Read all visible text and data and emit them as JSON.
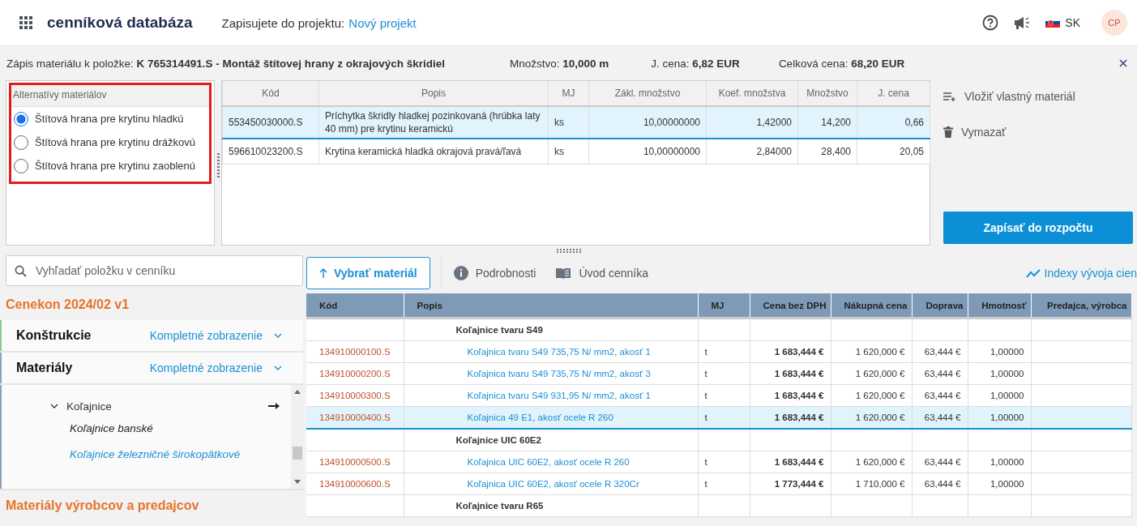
{
  "header": {
    "app_title": "cenníková databáza",
    "project_label": "Zapisujete do projektu:",
    "project_link": "Nový projekt",
    "language": "SK",
    "avatar": "CP"
  },
  "item_info": {
    "label": "Zápis materiálu k položke: **K 765314491.S - Montáž štítovej hrany z okrajových škridiel**",
    "quantity": "Množstvo: **10,000 m**",
    "unit_price": "J. cena: **6,82 EUR**",
    "total_price": "Celková cena: **68,20 EUR**"
  },
  "alternatives": {
    "title": "Alternatívy materiálov",
    "options": [
      {
        "label": "Štítová hrana pre krytinu hladkú",
        "selected": true
      },
      {
        "label": "Štítová hrana pre krytinu drážkovú",
        "selected": false
      },
      {
        "label": "Štítová hrana pre krytinu zaoblenú",
        "selected": false
      }
    ]
  },
  "materials_table": {
    "columns": [
      "Kód",
      "Popis",
      "MJ",
      "Zákl. množstvo",
      "Koef. množstva",
      "Množstvo",
      "J. cena"
    ],
    "rows": [
      {
        "selected": true,
        "cells": [
          "553450030000.S",
          "Príchytka škridly hladkej pozinkovaná (hrúbka laty 40 mm) pre krytinu keramickú",
          "ks",
          "10,00000000",
          "1,42000",
          "14,200",
          "0,66"
        ]
      },
      {
        "selected": false,
        "cells": [
          "596610023200.S",
          "Krytina keramická hladká okrajová pravá/ľavá",
          "ks",
          "10,00000000",
          "2,84000",
          "28,400",
          "20,05"
        ]
      }
    ]
  },
  "actions": [
    {
      "kind": "insert",
      "label": "Vložiť vlastný materiál"
    },
    {
      "kind": "delete",
      "label": "Vymazať"
    }
  ],
  "submit_button": "Zapísať do rozpočtu",
  "search": {
    "placeholder": "Vyhľadať položku v cenníku"
  },
  "catalog_title": "Cenekon 2024/02 v1",
  "sections": [
    {
      "title": "Konštrukcie",
      "view": "Kompletné zobrazenie",
      "color": "#8bc98b"
    },
    {
      "title": "Materiály",
      "view": "Kompletné zobrazenie",
      "color": "#8aa0bd"
    }
  ],
  "tree": [
    {
      "label": "Koľajnice",
      "expanded": true,
      "children": [
        {
          "label": "Koľajnice banské",
          "selected": false
        },
        {
          "label": "Koľajnice železničné širokopätkové",
          "selected": true
        }
      ]
    }
  ],
  "footer_title": "Materiály výrobcov a predajcov",
  "toolbar": {
    "select_button": "Vybrať materiál",
    "details": "Podrobnosti",
    "intro": "Úvod cenníka",
    "indexes": "Indexy vývoja cien"
  },
  "price_table": {
    "columns": [
      "Kód",
      "Popis",
      "MJ",
      "Cena bez DPH",
      "Nákupná cena",
      "Doprava",
      "Hmotnosť",
      "Predajca, výrobca"
    ],
    "rows": [
      {
        "kind": "group",
        "selected": false,
        "cells": [
          "",
          "Koľajnice tvaru S49"
        ]
      },
      {
        "kind": "item",
        "selected": false,
        "cells": [
          "134910000100.S",
          "Koľajnica tvaru S49 735,75 N/ mm2, akosť 1",
          "t",
          "1 683,444 €",
          "1 620,000 €",
          "63,444 €",
          "1,00000"
        ]
      },
      {
        "kind": "item",
        "selected": false,
        "cells": [
          "134910000200.S",
          "Koľajnica tvaru S49 735,75 N/ mm2, akosť 3",
          "t",
          "1 683,444 €",
          "1 620,000 €",
          "63,444 €",
          "1,00000"
        ]
      },
      {
        "kind": "item",
        "selected": false,
        "cells": [
          "134910000300.S",
          "Koľajnica tvaru S49 931,95 N/ mm2, akosť 1",
          "t",
          "1 683,444 €",
          "1 620,000 €",
          "63,444 €",
          "1,00000"
        ]
      },
      {
        "kind": "item",
        "selected": true,
        "cells": [
          "134910000400.S",
          "Koľajnica 49 E1, akosť ocele R 260",
          "t",
          "1 683,444 €",
          "1 620,000 €",
          "63,444 €",
          "1,00000"
        ]
      },
      {
        "kind": "group",
        "selected": false,
        "cells": [
          "",
          "Koľajnice UIC 60E2"
        ]
      },
      {
        "kind": "item",
        "selected": false,
        "cells": [
          "134910000500.S",
          "Koľajnica UIC 60E2, akosť ocele R 260",
          "t",
          "1 683,444 €",
          "1 620,000 €",
          "63,444 €",
          "1,00000"
        ]
      },
      {
        "kind": "item",
        "selected": false,
        "cells": [
          "134910000600.S",
          "Koľajnica UIC 60E2, akosť ocele R 320Cr",
          "t",
          "1 773,444 €",
          "1 710,000 €",
          "63,444 €",
          "1,00000"
        ]
      },
      {
        "kind": "group",
        "selected": false,
        "cells": [
          "",
          "Koľajnice tvaru R65"
        ]
      }
    ]
  }
}
